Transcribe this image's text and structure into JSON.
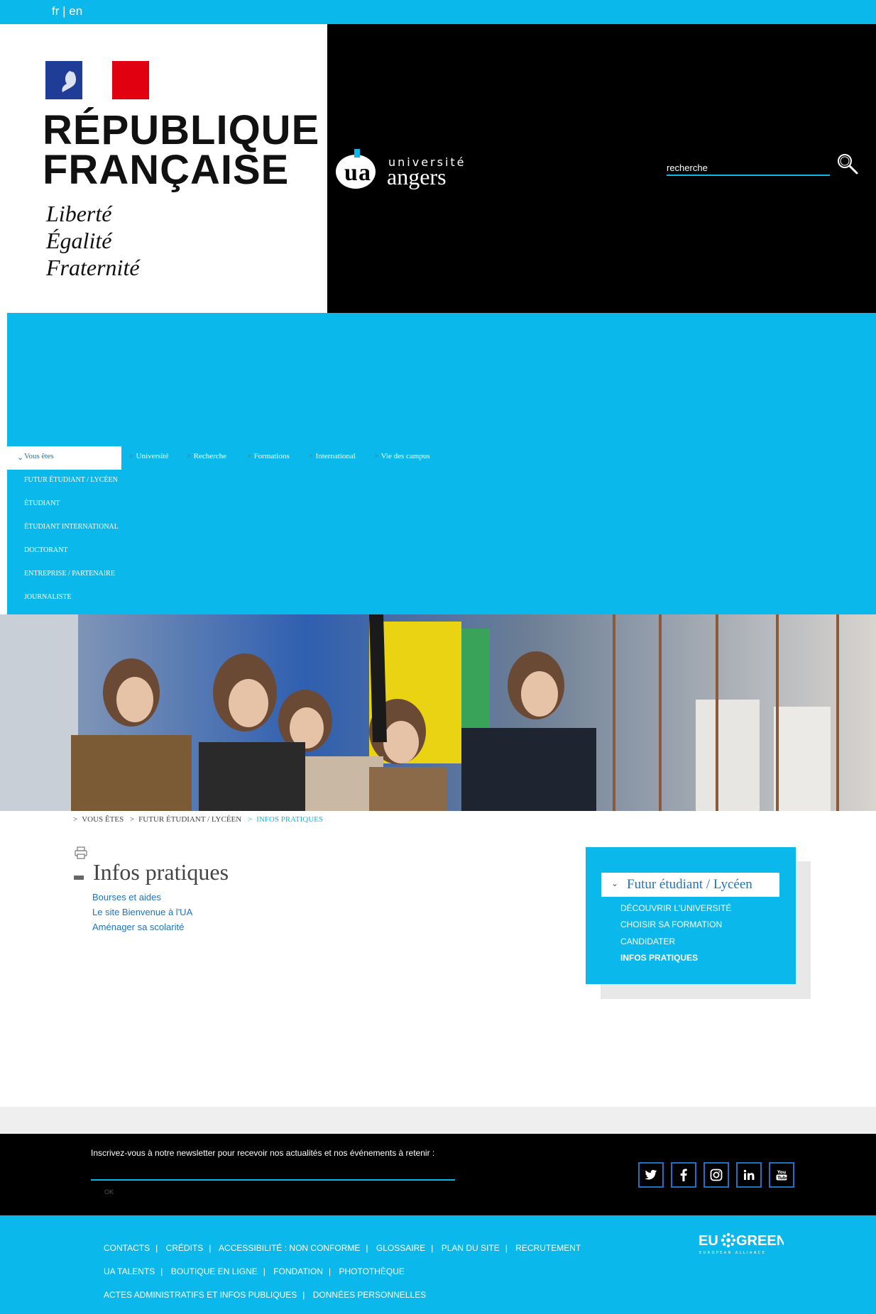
{
  "lang_switch": {
    "fr": "fr",
    "sep": "|",
    "en": "en"
  },
  "republique": {
    "title_line1": "RÉPUBLIQUE",
    "title_line2": "FRANÇAISE",
    "motto_1": "Liberté",
    "motto_2": "Égalité",
    "motto_3": "Fraternité"
  },
  "ua_logo": {
    "line1": "université",
    "line2": "angers"
  },
  "search": {
    "placeholder": "recherche"
  },
  "nav": {
    "active": "Vous êtes",
    "items": [
      "Université",
      "Recherche",
      "Formations",
      "International",
      "Vie des campus"
    ],
    "sub_items": [
      "Futur étudiant / Lycéen",
      "Étudiant",
      "Étudiant international",
      "Doctorant",
      "Entreprise / Partenaire",
      "Journaliste"
    ]
  },
  "breadcrumb": [
    "VOUS ÊTES",
    "FUTUR ÉTUDIANT / LYCÉEN",
    "INFOS PRATIQUES"
  ],
  "main": {
    "title": "Infos pratiques",
    "links": [
      "Bourses et aides",
      "Le site Bienvenue à l'UA",
      "Aménager sa scolarité"
    ]
  },
  "sidebar": {
    "heading": "Futur étudiant / Lycéen",
    "links": [
      "DÉCOUVRIR L'UNIVERSITÉ",
      "CHOISIR SA FORMATION",
      "CANDIDATER",
      "INFOS PRATIQUES"
    ]
  },
  "newsletter": {
    "text": "Inscrivez-vous à notre newsletter pour recevoir nos actualités et nos événements à retenir :",
    "ok": "OK"
  },
  "social": [
    "twitter-icon",
    "facebook-icon",
    "instagram-icon",
    "linkedin-icon",
    "youtube-icon"
  ],
  "footer": {
    "row1": [
      "CONTACTS",
      "CRÉDITS",
      "ACCESSIBILITÉ : NON CONFORME",
      "GLOSSAIRE",
      "PLAN DU SITE",
      "RECRUTEMENT"
    ],
    "row2": [
      "UA TALENTS",
      "BOUTIQUE EN LIGNE",
      "FONDATION",
      "PHOTOTHÈQUE"
    ],
    "row3": [
      "ACTES ADMINISTRATIFS ET INFOS PUBLIQUES",
      "DONNÉES PERSONNELLES"
    ],
    "eu_logo": {
      "text_eu": "EU",
      "text_green": "GREEN",
      "tagline": "EUROPEAN ALLIANCE"
    }
  },
  "colors": {
    "accent": "#0bb8ec",
    "link": "#1a73c7",
    "header_bg": "#000000"
  }
}
